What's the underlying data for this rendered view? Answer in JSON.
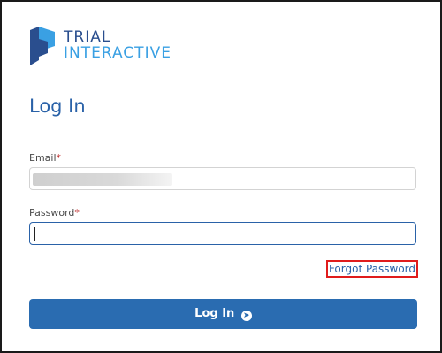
{
  "brand": {
    "line1": "TRIAL",
    "line2": "INTERACTIVE"
  },
  "page": {
    "title": "Log In"
  },
  "form": {
    "email_label": "Email",
    "password_label": "Password",
    "required_mark": "*",
    "password_value": "",
    "forgot_label": "Forgot Password",
    "submit_label": "Log In",
    "submit_icon": "circle-arrow-right-icon"
  },
  "colors": {
    "brand_dark": "#2a4e8e",
    "brand_light": "#3aa0e3",
    "primary": "#2a6cb1",
    "highlight": "#e01c1c"
  }
}
